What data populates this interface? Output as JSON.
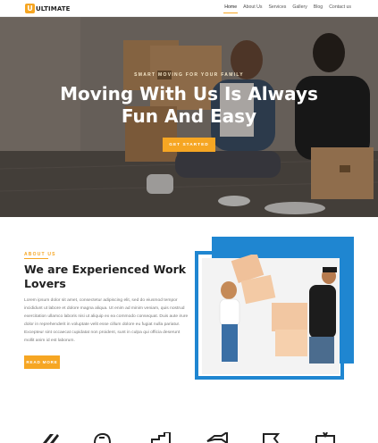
{
  "brand": {
    "logo_letter": "U",
    "name": "ULTIMATE"
  },
  "nav": {
    "items": [
      {
        "label": "Home",
        "active": true
      },
      {
        "label": "About Us",
        "active": false
      },
      {
        "label": "Services",
        "active": false
      },
      {
        "label": "Gallery",
        "active": false
      },
      {
        "label": "Blog",
        "active": false
      },
      {
        "label": "Contact us",
        "active": false
      }
    ]
  },
  "hero": {
    "eyebrow": "SMART MOVING FOR YOUR FAMILY",
    "title_line1": "Moving With Us Is Always",
    "title_line2": "Fun And Easy",
    "cta": "GET STARTED"
  },
  "about": {
    "label": "ABOUT US",
    "heading_line1": "We are Experienced Work",
    "heading_line2": "Lovers",
    "body": "Lorem ipsum dolor sit amet, consectetur adipiscing elit, sed do eiusmod tempor incididunt ut labore et dolore magna aliqua. Ut enim ad minim veniam, quis nostrud exercitation ullamco laboris nisi ut aliquip ex ea commodo consequat. Duis aute irure dolor in reprehenderit in voluptate velit esse cillum dolore eu fugiat nulla pariatur. Excepteur sint occaecat cupidatat non proident, sunt in culpa qui officia deserunt mollit anim id est laborum.",
    "cta": "READ MORE"
  },
  "colors": {
    "accent": "#f6a623",
    "frame_blue": "#1f86d1",
    "heading": "#222222",
    "body_text": "#777777"
  },
  "service_icons": [
    "bird-icon",
    "fist-icon",
    "boxes-icon",
    "megaphone-icon",
    "flag-icon",
    "billboard-icon"
  ]
}
